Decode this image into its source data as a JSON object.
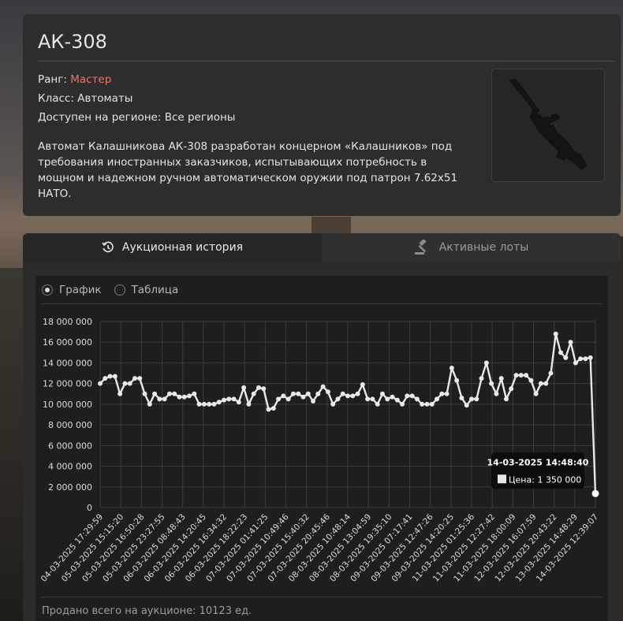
{
  "item": {
    "title": "АК-308",
    "rank_label": "Ранг: ",
    "rank_value": "Мастер",
    "rank_color": "#e07a72",
    "class_line": "Класс: Автоматы",
    "region_line": "Доступен на регионе: Все регионы",
    "description": "Автомат Калашникова АК-308 разработан концерном «Калашников» под требования иностранных заказчиков, испытывающих потребность в мощном и надежном ручном автоматическом оружии под патрон 7.62x51 НАТО."
  },
  "tabs": [
    {
      "label": "Аукционная история",
      "icon": "history-icon",
      "active": true
    },
    {
      "label": "Активные лоты",
      "icon": "gavel-icon",
      "active": false
    }
  ],
  "view_toggle": {
    "options": [
      {
        "label": "График",
        "selected": true
      },
      {
        "label": "Таблица",
        "selected": false
      }
    ]
  },
  "footer": {
    "sold_total": "Продано всего на аукционе: 10123 ед."
  },
  "tooltip": {
    "date": "14-03-2025 14:48:40",
    "price_line": "Цена: 1 350 000"
  },
  "chart_data": {
    "type": "line",
    "ylim": [
      0,
      18000000
    ],
    "y_ticks": [
      "0",
      "2 000 000",
      "4 000 000",
      "6 000 000",
      "8 000 000",
      "10 000 000",
      "12 000 000",
      "14 000 000",
      "16 000 000",
      "18 000 000"
    ],
    "y_tick_values": [
      0,
      2000000,
      4000000,
      6000000,
      8000000,
      10000000,
      12000000,
      14000000,
      16000000,
      18000000
    ],
    "x_tick_labels": [
      "04-03-2025 17:29:59",
      "05-03-2025 15:15:20",
      "05-03-2025 16:50:28",
      "05-03-2025 23:27:55",
      "06-03-2025 08:48:43",
      "06-03-2025 14:20:45",
      "06-03-2025 16:34:32",
      "06-03-2025 18:22:23",
      "07-03-2025 01:41:25",
      "07-03-2025 10:49:46",
      "07-03-2025 15:40:32",
      "07-03-2025 20:45:46",
      "08-03-2025 10:48:14",
      "08-03-2025 13:04:59",
      "08-03-2025 19:35:10",
      "09-03-2025 07:17:41",
      "09-03-2025 12:47:26",
      "09-03-2025 14:20:25",
      "11-03-2025 01:25:36",
      "11-03-2025 12:27:42",
      "11-03-2025 18:00:09",
      "12-03-2025 16:07:59",
      "12-03-2025 20:43:22",
      "13-03-2025 14:48:29",
      "14-03-2025 12:39:07"
    ],
    "values": [
      12000000,
      12500000,
      12700000,
      12700000,
      11000000,
      12000000,
      12000000,
      12500000,
      12500000,
      11000000,
      10000000,
      11000000,
      10500000,
      10500000,
      11000000,
      11000000,
      10700000,
      10700000,
      10800000,
      11000000,
      10000000,
      10000000,
      10000000,
      10000000,
      10200000,
      10400000,
      10500000,
      10500000,
      10200000,
      11600000,
      10000000,
      11000000,
      11600000,
      11500000,
      9500000,
      9600000,
      10500000,
      10800000,
      10500000,
      11000000,
      11000000,
      10700000,
      11000000,
      10300000,
      11000000,
      11700000,
      11200000,
      10000000,
      10500000,
      11000000,
      10800000,
      10800000,
      11000000,
      11900000,
      10500000,
      10500000,
      10000000,
      11000000,
      10500000,
      10700000,
      10400000,
      10000000,
      10800000,
      10800000,
      10500000,
      10000000,
      10000000,
      10000000,
      10500000,
      11000000,
      11000000,
      13500000,
      12300000,
      10600000,
      9900000,
      10500000,
      10500000,
      12500000,
      14000000,
      12000000,
      11000000,
      12500000,
      10500000,
      11500000,
      12800000,
      12800000,
      12800000,
      12300000,
      11000000,
      12000000,
      12000000,
      13000000,
      16800000,
      15000000,
      14500000,
      16000000,
      14000000,
      14400000,
      14400000,
      14500000,
      1350000
    ],
    "line_color": "#e8e8e8",
    "grid": true
  }
}
